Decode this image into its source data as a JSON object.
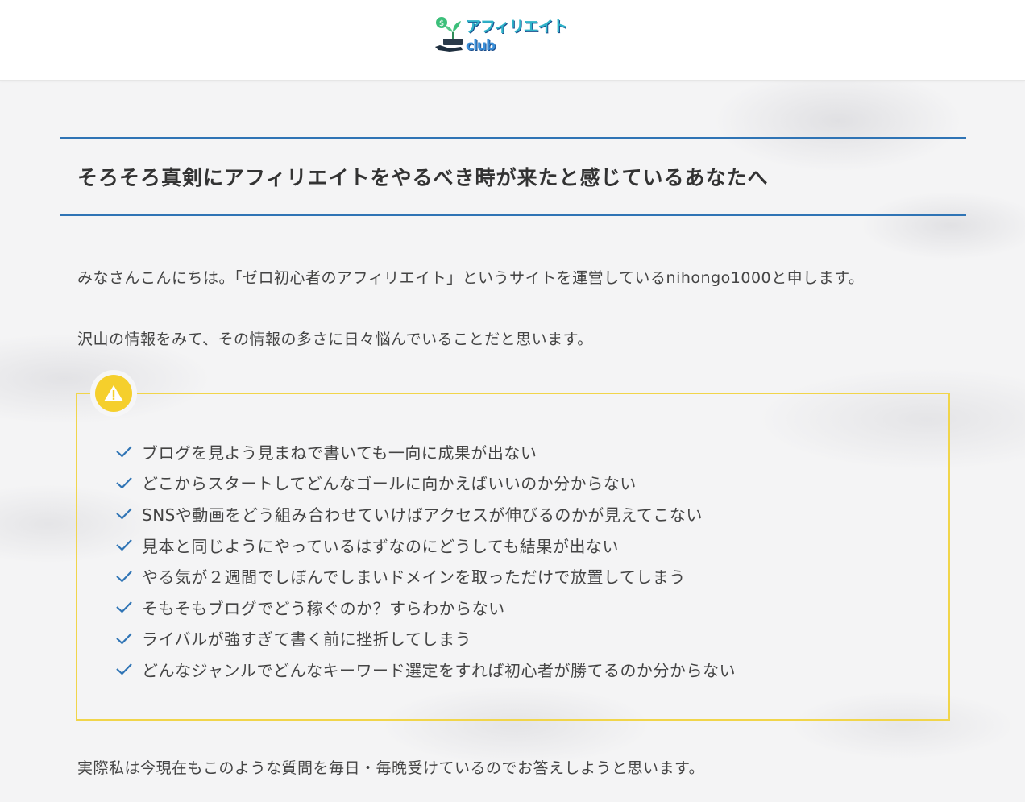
{
  "header": {
    "logo_text_main": "アフィリエイト",
    "logo_text_club": "club",
    "logo_badge": "$"
  },
  "main": {
    "title": "そろそろ真剣にアフィリエイトをやるべき時が来たと感じているあなたへ",
    "intro_1": "みなさんこんにちは。「ゼロ初心者のアフィリエイト」というサイトを運営しているnihongo1000と申します。",
    "intro_2": "沢山の情報をみて、その情報の多さに日々悩んでいることだと思います。",
    "caution_items": [
      "ブログを見よう見まねで書いても一向に成果が出ない",
      "どこからスタートしてどんなゴールに向かえばいいのか分からない",
      "SNSや動画をどう組み合わせていけばアクセスが伸びるのかが見えてこない",
      "見本と同じようにやっているはずなのにどうしても結果が出ない",
      "やる気が２週間でしぼんでしまいドメインを取っただけで放置してしまう",
      "そもそもブログでどう稼ぐのか？すらわからない",
      "ライバルが強すぎて書く前に挫折してしまう",
      "どんなジャンルでどんなキーワード選定をすれば初心者が勝てるのか分からない"
    ],
    "closing": "実際私は今現在もこのような質問を毎日・毎晩受けているのでお答えしようと思います。"
  },
  "colors": {
    "title_rule": "#2f74b5",
    "caution_border": "#f1d54a",
    "caution_icon": "#f5cf2c",
    "check": "#2f74b5"
  },
  "icons": {
    "caution": "warning-icon",
    "check": "check-icon"
  }
}
